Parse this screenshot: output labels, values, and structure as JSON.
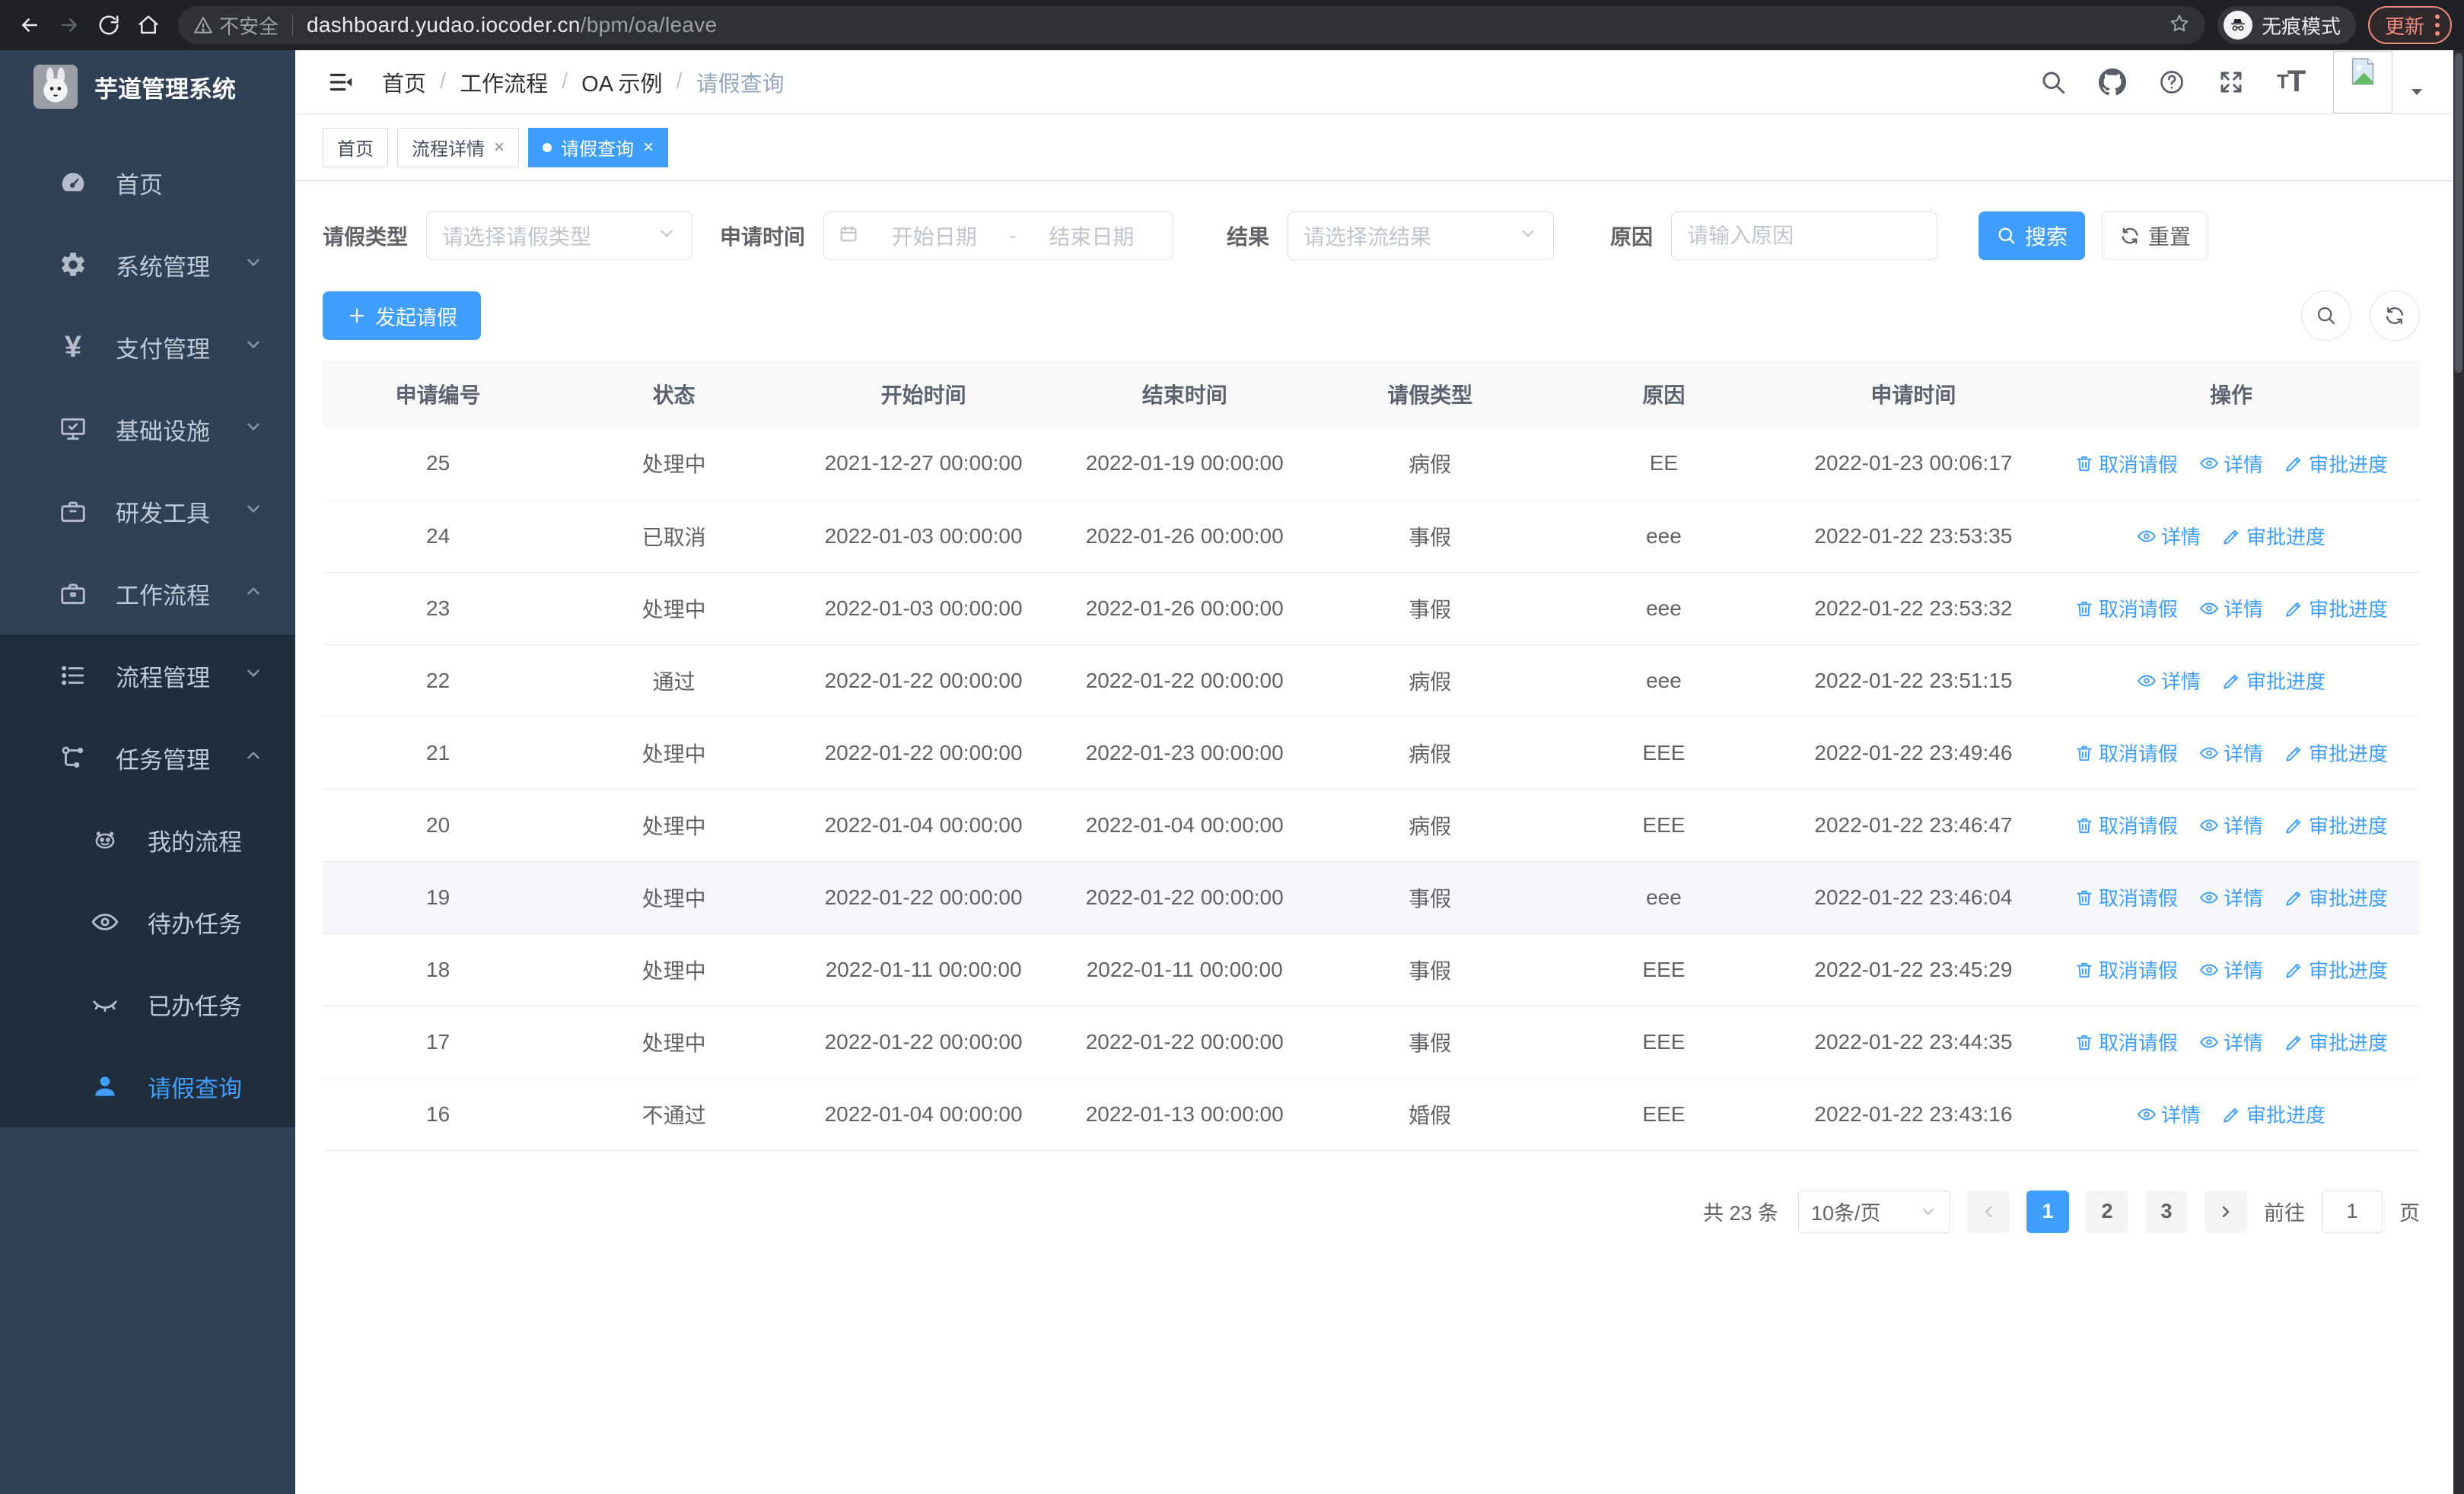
{
  "browser": {
    "security_label": "不安全",
    "url_host": "dashboard.yudao.iocoder.cn",
    "url_path": "/bpm/oa/leave",
    "incognito_label": "无痕模式",
    "update_label": "更新"
  },
  "sidebar": {
    "title": "芋道管理系统",
    "items": [
      {
        "label": "首页"
      },
      {
        "label": "系统管理"
      },
      {
        "label": "支付管理"
      },
      {
        "label": "基础设施"
      },
      {
        "label": "研发工具"
      },
      {
        "label": "工作流程"
      },
      {
        "label": "流程管理"
      },
      {
        "label": "任务管理"
      },
      {
        "label": "我的流程"
      },
      {
        "label": "待办任务"
      },
      {
        "label": "已办任务"
      },
      {
        "label": "请假查询"
      }
    ]
  },
  "header": {
    "breadcrumbs": [
      "首页",
      "工作流程",
      "OA 示例",
      "请假查询"
    ]
  },
  "tabs": [
    {
      "label": "首页"
    },
    {
      "label": "流程详情"
    },
    {
      "label": "请假查询"
    }
  ],
  "filters": {
    "leave_type_label": "请假类型",
    "leave_type_placeholder": "请选择请假类型",
    "apply_time_label": "申请时间",
    "start_placeholder": "开始日期",
    "range_separator": "-",
    "end_placeholder": "结束日期",
    "result_label": "结果",
    "result_placeholder": "请选择流结果",
    "reason_label": "原因",
    "reason_placeholder": "请输入原因",
    "search_label": "搜索",
    "reset_label": "重置"
  },
  "toolbar": {
    "create_label": "发起请假"
  },
  "table": {
    "columns": [
      "申请编号",
      "状态",
      "开始时间",
      "结束时间",
      "请假类型",
      "原因",
      "申请时间",
      "操作"
    ],
    "action_labels": {
      "cancel": "取消请假",
      "detail": "详情",
      "progress": "审批进度"
    },
    "rows": [
      {
        "id": "25",
        "status": "处理中",
        "start": "2021-12-27 00:00:00",
        "end": "2022-01-19 00:00:00",
        "type": "病假",
        "reason": "EE",
        "applied": "2022-01-23 00:06:17",
        "actions": [
          "cancel",
          "detail",
          "progress"
        ],
        "highlighted": false
      },
      {
        "id": "24",
        "status": "已取消",
        "start": "2022-01-03 00:00:00",
        "end": "2022-01-26 00:00:00",
        "type": "事假",
        "reason": "eee",
        "applied": "2022-01-22 23:53:35",
        "actions": [
          "detail",
          "progress"
        ],
        "highlighted": false
      },
      {
        "id": "23",
        "status": "处理中",
        "start": "2022-01-03 00:00:00",
        "end": "2022-01-26 00:00:00",
        "type": "事假",
        "reason": "eee",
        "applied": "2022-01-22 23:53:32",
        "actions": [
          "cancel",
          "detail",
          "progress"
        ],
        "highlighted": false
      },
      {
        "id": "22",
        "status": "通过",
        "start": "2022-01-22 00:00:00",
        "end": "2022-01-22 00:00:00",
        "type": "病假",
        "reason": "eee",
        "applied": "2022-01-22 23:51:15",
        "actions": [
          "detail",
          "progress"
        ],
        "highlighted": false
      },
      {
        "id": "21",
        "status": "处理中",
        "start": "2022-01-22 00:00:00",
        "end": "2022-01-23 00:00:00",
        "type": "病假",
        "reason": "EEE",
        "applied": "2022-01-22 23:49:46",
        "actions": [
          "cancel",
          "detail",
          "progress"
        ],
        "highlighted": false
      },
      {
        "id": "20",
        "status": "处理中",
        "start": "2022-01-04 00:00:00",
        "end": "2022-01-04 00:00:00",
        "type": "病假",
        "reason": "EEE",
        "applied": "2022-01-22 23:46:47",
        "actions": [
          "cancel",
          "detail",
          "progress"
        ],
        "highlighted": false
      },
      {
        "id": "19",
        "status": "处理中",
        "start": "2022-01-22 00:00:00",
        "end": "2022-01-22 00:00:00",
        "type": "事假",
        "reason": "eee",
        "applied": "2022-01-22 23:46:04",
        "actions": [
          "cancel",
          "detail",
          "progress"
        ],
        "highlighted": true
      },
      {
        "id": "18",
        "status": "处理中",
        "start": "2022-01-11 00:00:00",
        "end": "2022-01-11 00:00:00",
        "type": "事假",
        "reason": "EEE",
        "applied": "2022-01-22 23:45:29",
        "actions": [
          "cancel",
          "detail",
          "progress"
        ],
        "highlighted": false
      },
      {
        "id": "17",
        "status": "处理中",
        "start": "2022-01-22 00:00:00",
        "end": "2022-01-22 00:00:00",
        "type": "事假",
        "reason": "EEE",
        "applied": "2022-01-22 23:44:35",
        "actions": [
          "cancel",
          "detail",
          "progress"
        ],
        "highlighted": false
      },
      {
        "id": "16",
        "status": "不通过",
        "start": "2022-01-04 00:00:00",
        "end": "2022-01-13 00:00:00",
        "type": "婚假",
        "reason": "EEE",
        "applied": "2022-01-22 23:43:16",
        "actions": [
          "detail",
          "progress"
        ],
        "highlighted": false
      }
    ]
  },
  "pagination": {
    "total_text": "共 23 条",
    "page_size": "10条/页",
    "pages": [
      "1",
      "2",
      "3"
    ],
    "current": "1",
    "goto_label": "前往",
    "goto_value": "1",
    "page_unit": "页"
  },
  "colors": {
    "primary": "#409eff",
    "sidebar_bg": "#304156",
    "submenu_bg": "#1f2d3d",
    "update_red": "#f28b82"
  }
}
